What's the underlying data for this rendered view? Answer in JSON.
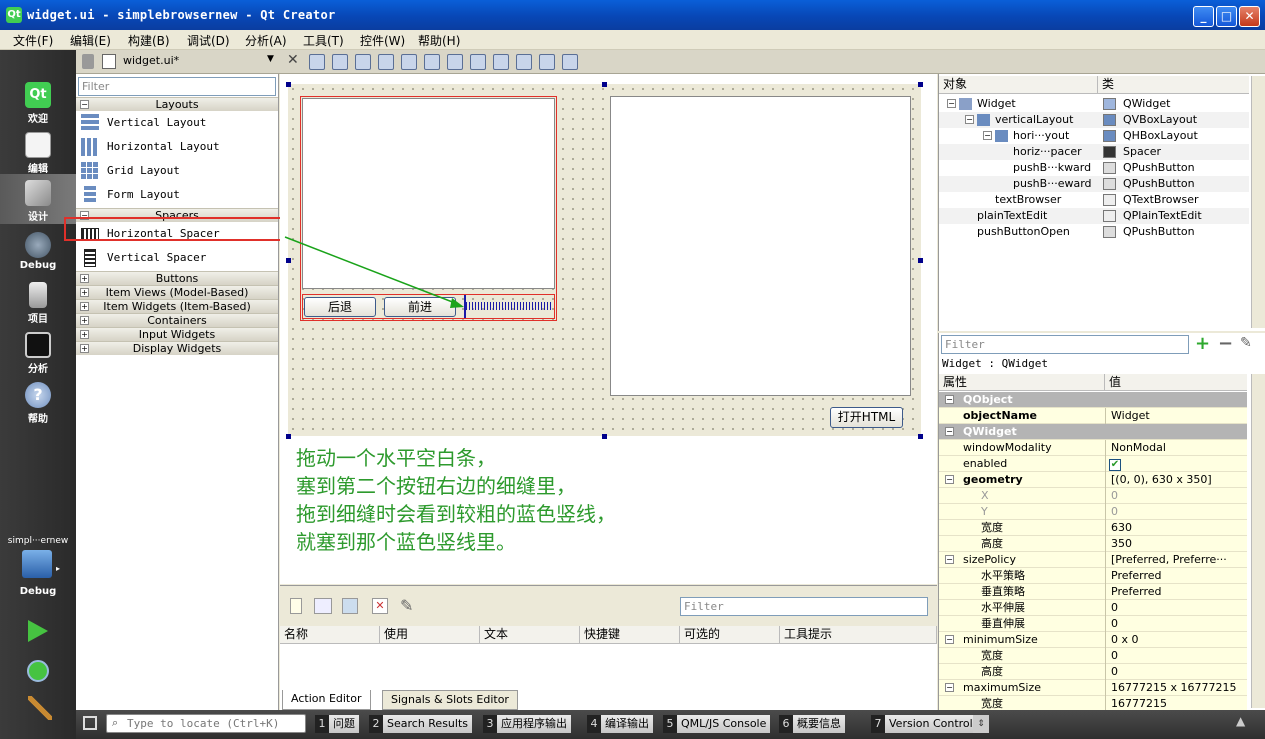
{
  "window": {
    "title": "widget.ui - simplebrowsernew - Qt Creator",
    "min": "_",
    "max": "□",
    "close": "✕"
  },
  "menu": [
    "文件(F)",
    "编辑(E)",
    "构建(B)",
    "调试(D)",
    "分析(A)",
    "工具(T)",
    "控件(W)",
    "帮助(H)"
  ],
  "modes": [
    {
      "label": "欢迎",
      "icon": "qt-welcome-icon"
    },
    {
      "label": "编辑",
      "icon": "edit-icon"
    },
    {
      "label": "设计",
      "icon": "design-icon",
      "active": true
    },
    {
      "label": "Debug",
      "icon": "debug-icon"
    },
    {
      "label": "项目",
      "icon": "projects-icon"
    },
    {
      "label": "分析",
      "icon": "analyze-icon"
    },
    {
      "label": "帮助",
      "icon": "help-icon"
    }
  ],
  "kit": {
    "project": "simpl···ernew",
    "mode": "Debug"
  },
  "file_tab": "widget.ui*",
  "widget_box": {
    "filter_placeholder": "Filter",
    "layouts": "Layouts",
    "vertical_layout": "Vertical Layout",
    "horizontal_layout": "Horizontal Layout",
    "grid_layout": "Grid Layout",
    "form_layout": "Form Layout",
    "spacers": "Spacers",
    "horizontal_spacer": "Horizontal Spacer",
    "vertical_spacer": "Vertical Spacer",
    "buttons": "Buttons",
    "item_views": "Item Views (Model-Based)",
    "item_widgets": "Item Widgets (Item-Based)",
    "containers": "Containers",
    "input_widgets": "Input Widgets",
    "display_widgets": "Display Widgets"
  },
  "form": {
    "back": "后退",
    "forward": "前进",
    "open_html": "打开HTML"
  },
  "annotation": [
    "拖动一个水平空白条，",
    "塞到第二个按钮右边的细缝里，",
    "拖到细缝时会看到较粗的蓝色竖线，",
    "就塞到那个蓝色竖线里。"
  ],
  "action_editor": {
    "filter_placeholder": "Filter",
    "columns": [
      "名称",
      "使用",
      "文本",
      "快捷键",
      "可选的",
      "工具提示"
    ],
    "tab_action": "Action Editor",
    "tab_signals": "Signals & Slots Editor"
  },
  "object_inspector": {
    "col_object": "对象",
    "col_class": "类",
    "rows": [
      {
        "obj": "Widget",
        "cls": "QWidget"
      },
      {
        "obj": "verticalLayout",
        "cls": "QVBoxLayout"
      },
      {
        "obj": "hori···yout",
        "cls": "QHBoxLayout"
      },
      {
        "obj": "horiz···pacer",
        "cls": "Spacer"
      },
      {
        "obj": "pushB···kward",
        "cls": "QPushButton"
      },
      {
        "obj": "pushB···eward",
        "cls": "QPushButton"
      },
      {
        "obj": "textBrowser",
        "cls": "QTextBrowser"
      },
      {
        "obj": "plainTextEdit",
        "cls": "QPlainTextEdit"
      },
      {
        "obj": "pushButtonOpen",
        "cls": "QPushButton"
      }
    ]
  },
  "property_editor": {
    "filter_placeholder": "Filter",
    "context": "Widget : QWidget",
    "col_prop": "属性",
    "col_val": "值",
    "rows": [
      {
        "n": "QObject",
        "v": "",
        "t": "g"
      },
      {
        "n": "objectName",
        "v": "Widget",
        "t": "y",
        "bold": true
      },
      {
        "n": "QWidget",
        "v": "",
        "t": "g"
      },
      {
        "n": "windowModality",
        "v": "NonModal",
        "t": "y"
      },
      {
        "n": "enabled",
        "v": "✔",
        "t": "y"
      },
      {
        "n": "geometry",
        "v": "[(0, 0), 630 x 350]",
        "t": "y",
        "bold": true
      },
      {
        "n": "X",
        "v": "0",
        "t": "y",
        "sub": true,
        "grey": true
      },
      {
        "n": "Y",
        "v": "0",
        "t": "y",
        "sub": true,
        "grey": true
      },
      {
        "n": "宽度",
        "v": "630",
        "t": "y",
        "sub": true
      },
      {
        "n": "高度",
        "v": "350",
        "t": "y",
        "sub": true
      },
      {
        "n": "sizePolicy",
        "v": "[Preferred, Preferre···",
        "t": "y"
      },
      {
        "n": "水平策略",
        "v": "Preferred",
        "t": "y",
        "sub": true
      },
      {
        "n": "垂直策略",
        "v": "Preferred",
        "t": "y",
        "sub": true
      },
      {
        "n": "水平伸展",
        "v": "0",
        "t": "y",
        "sub": true
      },
      {
        "n": "垂直伸展",
        "v": "0",
        "t": "y",
        "sub": true
      },
      {
        "n": "minimumSize",
        "v": "0 x 0",
        "t": "y"
      },
      {
        "n": "宽度",
        "v": "0",
        "t": "y",
        "sub": true
      },
      {
        "n": "高度",
        "v": "0",
        "t": "y",
        "sub": true
      },
      {
        "n": "maximumSize",
        "v": "16777215 x 16777215",
        "t": "y"
      },
      {
        "n": "宽度",
        "v": "16777215",
        "t": "y",
        "sub": true
      }
    ]
  },
  "statusbar": {
    "locate_placeholder": "Type to locate (Ctrl+K)",
    "panes": [
      {
        "num": "1",
        "label": "问题"
      },
      {
        "num": "2",
        "label": "Search Results"
      },
      {
        "num": "3",
        "label": "应用程序输出"
      },
      {
        "num": "4",
        "label": "编译输出"
      },
      {
        "num": "5",
        "label": "QML/JS Console"
      },
      {
        "num": "6",
        "label": "概要信息"
      },
      {
        "num": "7",
        "label": "Version Control"
      }
    ]
  },
  "colors": {
    "highlight_box": "#e0302a",
    "arrow": "#1aa31a",
    "annotation": "#2d9a2d",
    "spacer": "#1a1aa8"
  }
}
